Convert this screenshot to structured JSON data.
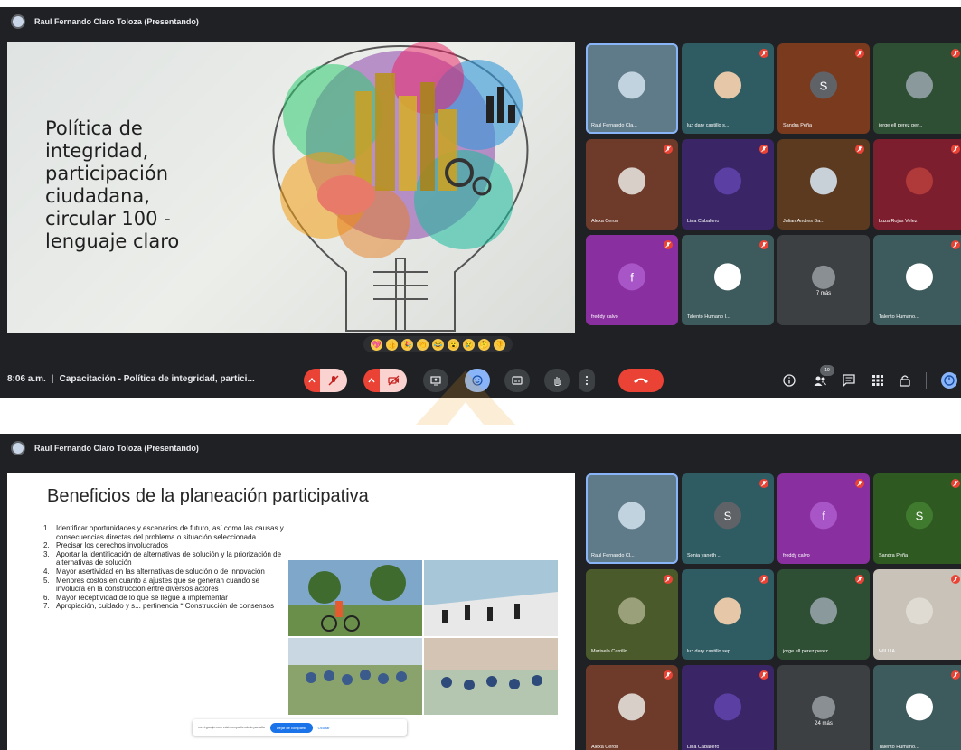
{
  "screenshot1": {
    "presenting_text": "Raul Fernando Claro Toloza (Presentando)",
    "slide_title": "Política de\nintegridad,\nparticipación\nciudadana,\ncircular 100 -\nlenguaje claro",
    "participants": [
      {
        "name": "Raul Fernando Cla...",
        "bg": "#5f7a88",
        "avatar_bg": "#c0d3df",
        "initial": "",
        "muted": false,
        "focused": true
      },
      {
        "name": "luz dary castillo s...",
        "bg": "#2f5b63",
        "avatar_bg": "#e6c7a8",
        "initial": "",
        "muted": true,
        "focused": false
      },
      {
        "name": "Sandra Peña",
        "bg": "#7a3a1e",
        "avatar_bg": "#5f6368",
        "initial": "S",
        "muted": true,
        "focused": false
      },
      {
        "name": "jorge ell perez per...",
        "bg": "#2f4f35",
        "avatar_bg": "#8a9a9c",
        "initial": "",
        "muted": true,
        "focused": false
      },
      {
        "name": "Alexa Ceron",
        "bg": "#6e3a2a",
        "avatar_bg": "#d7cfc8",
        "initial": "",
        "muted": true,
        "focused": false
      },
      {
        "name": "Lina Caballero",
        "bg": "#3a2566",
        "avatar_bg": "#5b3fa3",
        "initial": "",
        "muted": true,
        "focused": false
      },
      {
        "name": "Julian Andres Ba...",
        "bg": "#5b3a1f",
        "avatar_bg": "#c8d0d8",
        "initial": "",
        "muted": true,
        "focused": false
      },
      {
        "name": "Luza Rojas Velez",
        "bg": "#7d1e2e",
        "avatar_bg": "#b03a3a",
        "initial": "",
        "muted": true,
        "focused": false
      },
      {
        "name": "freddy calvo",
        "bg": "#8a2fa0",
        "avatar_bg": "#a855c7",
        "initial": "f",
        "muted": true,
        "focused": false
      },
      {
        "name": "Talento Humano I...",
        "bg": "#3d5a5c",
        "avatar_bg": "#ffffff",
        "initial": "",
        "muted": true,
        "focused": false
      },
      {
        "name": "",
        "bg": "#3c4043",
        "avatar_bg": "#8a8f94",
        "initial": "",
        "muted": false,
        "focused": false,
        "more": "7 más"
      },
      {
        "name": "Talento Humano...",
        "bg": "#3d5a5c",
        "avatar_bg": "#ffffff",
        "initial": "",
        "muted": true,
        "focused": false
      }
    ],
    "reactions": [
      "💖",
      "👍",
      "🎉",
      "👏",
      "😂",
      "😮",
      "😢",
      "🤔",
      "👎"
    ],
    "time": "8:06 a.m.",
    "meeting_name": "Capacitación - Política de integridad, partici...",
    "participant_count": "19",
    "colors": {
      "mute_red": "#ea4335",
      "leave_red": "#ea4335",
      "active_blue": "#8ab4f8",
      "control_gray": "#3c4043"
    }
  },
  "screenshot2": {
    "presenting_text": "Raul Fernando Claro Toloza (Presentando)",
    "slide_title": "Beneficios de la planeación participativa",
    "list_items": [
      {
        "num": "1.",
        "text": "Identificar oportunidades y escenarios de futuro, así como las causas y consecuencias directas del problema o situación seleccionada."
      },
      {
        "num": "2.",
        "text": "Precisar los derechos involucrados"
      },
      {
        "num": "3.",
        "text": "Aportar la identificación de alternativas de solución y la priorización de alternativas de solución"
      },
      {
        "num": "4.",
        "text": "Mayor asertividad en las alternativas de solución o de innovación"
      },
      {
        "num": "5.",
        "text": "Menores costos en cuanto a ajustes que se generan cuando se involucra en la construcción entre diversos actores"
      },
      {
        "num": "6.",
        "text": "Mayor receptividad de lo que se llegue a implementar"
      },
      {
        "num": "7.",
        "text": "Apropiación, cuidado y s... pertinencia * Construcción de consensos"
      }
    ],
    "share_banner": {
      "text": "meet.google.com está compartiendo tu pantalla",
      "stop_label": "Dejar de compartir",
      "hide_label": "Ocultar"
    },
    "participants": [
      {
        "name": "Raul Fernando Cl...",
        "bg": "#5f7a88",
        "avatar_bg": "#c0d3df",
        "initial": "",
        "muted": false,
        "focused": true
      },
      {
        "name": "Sonia yaneth ...",
        "bg": "#2f5b63",
        "avatar_bg": "#5f6368",
        "initial": "S",
        "muted": true,
        "focused": false
      },
      {
        "name": "freddy calvo",
        "bg": "#8a2fa0",
        "avatar_bg": "#a855c7",
        "initial": "f",
        "muted": true,
        "focused": false
      },
      {
        "name": "Sandra Peña",
        "bg": "#2e5a22",
        "avatar_bg": "#3f7a2f",
        "initial": "S",
        "muted": true,
        "focused": false
      },
      {
        "name": "Marisela Carrillo",
        "bg": "#4a5a2a",
        "avatar_bg": "#9aa07a",
        "initial": "",
        "muted": true,
        "focused": false
      },
      {
        "name": "luz dary castillo sep...",
        "bg": "#2f5b63",
        "avatar_bg": "#e6c7a8",
        "initial": "",
        "muted": true,
        "focused": false
      },
      {
        "name": "jorge ell perez perez",
        "bg": "#2f4f35",
        "avatar_bg": "#8a9a9c",
        "initial": "",
        "muted": true,
        "focused": false
      },
      {
        "name": "WILLIA...",
        "bg": "#c8c2b8",
        "avatar_bg": "#e0dbd2",
        "initial": "",
        "muted": true,
        "focused": false
      },
      {
        "name": "Alexa Ceron",
        "bg": "#6e3a2a",
        "avatar_bg": "#d7cfc8",
        "initial": "",
        "muted": true,
        "focused": false
      },
      {
        "name": "Lina Caballero",
        "bg": "#3a2566",
        "avatar_bg": "#5b3fa3",
        "initial": "",
        "muted": true,
        "focused": false
      },
      {
        "name": "",
        "bg": "#3c4043",
        "avatar_bg": "#8a8f94",
        "initial": "",
        "muted": false,
        "focused": false,
        "more": "24 más"
      },
      {
        "name": "Talento Humano...",
        "bg": "#3d5a5c",
        "avatar_bg": "#ffffff",
        "initial": "",
        "muted": true,
        "focused": false
      }
    ]
  }
}
